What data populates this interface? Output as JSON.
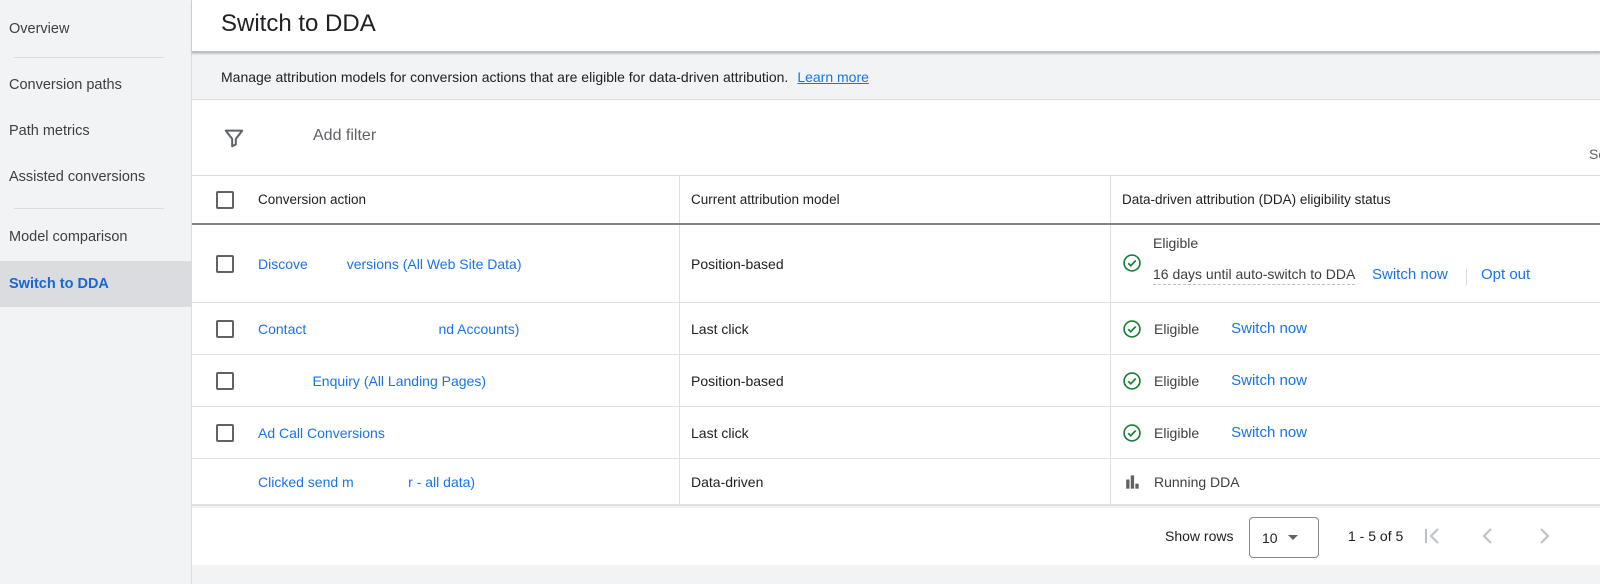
{
  "sidebar": {
    "items": [
      {
        "label": "Overview"
      },
      {
        "label": "Conversion paths"
      },
      {
        "label": "Path metrics"
      },
      {
        "label": "Assisted conversions"
      },
      {
        "label": "Model comparison"
      },
      {
        "label": "Switch to DDA",
        "active": true
      }
    ]
  },
  "header": {
    "title": "Switch to DDA"
  },
  "info": {
    "text": "Manage attribution models for conversion actions that are eligible for data-driven attribution.",
    "link": "Learn more"
  },
  "filter": {
    "icon": "filter-icon",
    "label": "Add filter",
    "search_stub": "Se"
  },
  "table": {
    "columns": [
      "Conversion action",
      "Current attribution model",
      "Data-driven attribution (DDA) eligibility status"
    ],
    "rows": [
      {
        "conversion_action": "Discove          versions (All Web Site Data)",
        "model": "Position-based",
        "status": "Eligible",
        "status_icon": "check-circle-icon",
        "detail": "16 days until auto-switch to DDA",
        "actions": [
          "Switch now",
          "Opt out"
        ]
      },
      {
        "conversion_action": "Contact                                  nd Accounts)",
        "model": "Last click",
        "status": "Eligible",
        "status_icon": "check-circle-icon",
        "actions": [
          "Switch now"
        ]
      },
      {
        "conversion_action": "              Enquiry (All Landing Pages)",
        "model": "Position-based",
        "status": "Eligible",
        "status_icon": "check-circle-icon",
        "actions": [
          "Switch now"
        ]
      },
      {
        "conversion_action": "Ad Call Conversions",
        "model": "Last click",
        "status": "Eligible",
        "status_icon": "check-circle-icon",
        "actions": [
          "Switch now"
        ]
      },
      {
        "conversion_action": "Clicked send m              r - all data)",
        "model": "Data-driven",
        "status": "Running DDA",
        "status_icon": "bar-chart-icon",
        "actions": []
      }
    ]
  },
  "pagination": {
    "show_rows_label": "Show rows",
    "rows_per_page": "10",
    "range": "1 - 5 of 5"
  },
  "colors": {
    "accent": "#1a73e8",
    "active_nav": "#1967d2",
    "success": "#188038"
  }
}
